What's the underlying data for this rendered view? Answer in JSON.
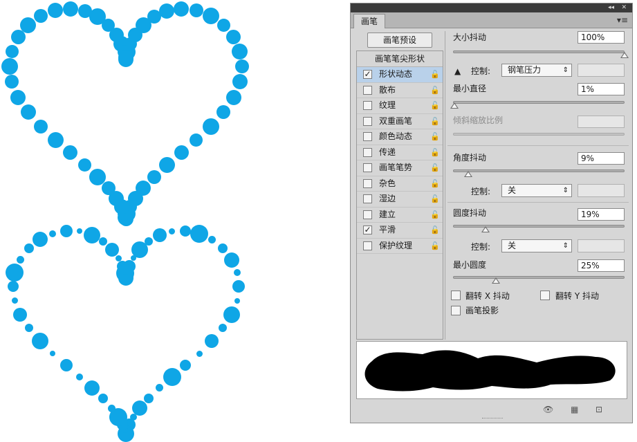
{
  "panel": {
    "collapse_icon": "double-chevron-left-icon",
    "collapse_glyph": "◂◂",
    "close_glyph": "✕",
    "tab_label": "画笔",
    "menu_glyph": "▾≡",
    "preset_button": "画笔预设"
  },
  "brush_list": {
    "header": "画笔笔尖形状",
    "items": [
      {
        "label": "形状动态",
        "checked": true,
        "selected": true
      },
      {
        "label": "散布",
        "checked": false
      },
      {
        "label": "纹理",
        "checked": false
      },
      {
        "label": "双重画笔",
        "checked": false
      },
      {
        "label": "颜色动态",
        "checked": false
      },
      {
        "label": "传递",
        "checked": false
      },
      {
        "label": "画笔笔势",
        "checked": false
      },
      {
        "label": "杂色",
        "checked": false
      },
      {
        "label": "湿边",
        "checked": false
      },
      {
        "label": "建立",
        "checked": false
      },
      {
        "label": "平滑",
        "checked": true
      },
      {
        "label": "保护纹理",
        "checked": false
      }
    ],
    "lock_glyph": "🔓"
  },
  "settings": {
    "size_jitter_label": "大小抖动",
    "size_jitter_value": "100%",
    "size_jitter_level": 1.0,
    "control_label": "控制:",
    "control1_value": "钢笔压力",
    "warning_glyph": "▲",
    "min_diameter_label": "最小直径",
    "min_diameter_value": "1%",
    "min_diameter_level": 0.01,
    "tilt_scale_label": "倾斜缩放比例",
    "angle_jitter_label": "角度抖动",
    "angle_jitter_value": "9%",
    "angle_jitter_level": 0.09,
    "control2_value": "关",
    "roundness_jitter_label": "圆度抖动",
    "roundness_jitter_value": "19%",
    "roundness_jitter_level": 0.19,
    "control3_value": "关",
    "min_roundness_label": "最小圆度",
    "min_roundness_value": "25%",
    "min_roundness_level": 0.25,
    "flip_x_label": "翻转 X 抖动",
    "flip_y_label": "翻转 Y 抖动",
    "brush_projection_label": "画笔投影",
    "select_arrow": "⇕"
  },
  "bottom_icons": {
    "eye_glyph": "👁",
    "grid_glyph": "▦",
    "new_glyph": "⊡"
  },
  "colors": {
    "dot_blue": "#0fa6e6",
    "panel_bg": "#d6d6d6",
    "selected_row": "#b9d1ea"
  }
}
